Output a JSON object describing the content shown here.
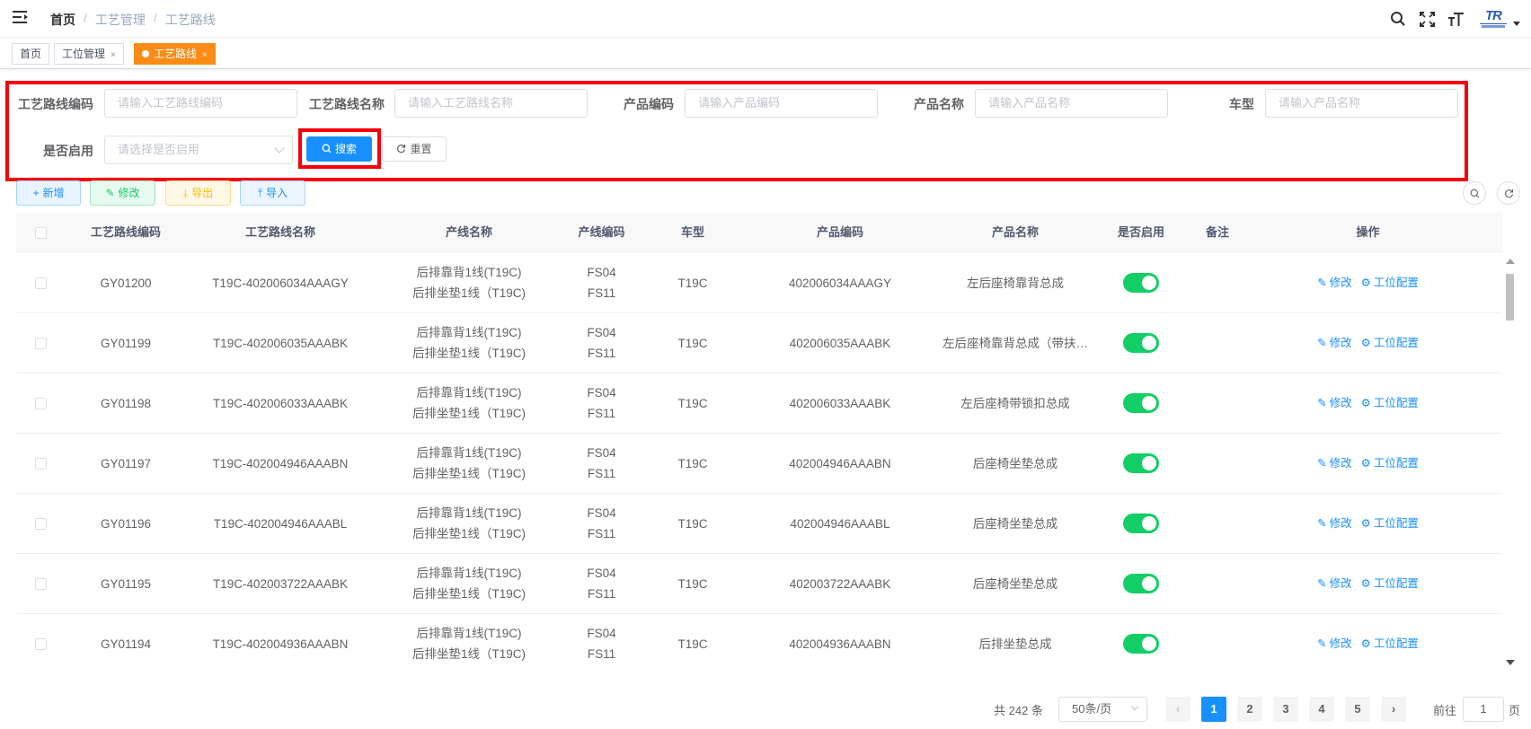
{
  "navbar": {
    "breadcrumb": [
      "首页",
      "工艺管理",
      "工艺路线"
    ],
    "logo_text": "TR"
  },
  "tags": [
    {
      "label": "首页"
    },
    {
      "label": "工位管理"
    },
    {
      "label": "工艺路线"
    }
  ],
  "search": {
    "fields": [
      {
        "label": "工艺路线编码",
        "placeholder": "请输入工艺路线编码"
      },
      {
        "label": "工艺路线名称",
        "placeholder": "请输入工艺路线名称"
      },
      {
        "label": "产品编码",
        "placeholder": "请输入产品编码"
      },
      {
        "label": "产品名称",
        "placeholder": "请输入产品名称"
      },
      {
        "label": "车型",
        "placeholder": "请输入产品名称"
      },
      {
        "label": "是否启用",
        "placeholder": "请选择是否启用"
      }
    ],
    "search_label": "搜索",
    "reset_label": "重置"
  },
  "toolbar": {
    "add": "新增",
    "edit": "修改",
    "export": "导出",
    "import": "导入"
  },
  "table": {
    "headers": [
      "工艺路线编码",
      "工艺路线名称",
      "产线名称",
      "产线编码",
      "车型",
      "产品编码",
      "产品名称",
      "是否启用",
      "备注",
      "操作"
    ],
    "rows": [
      {
        "code": "GY01200",
        "name": "T19C-402006034AAAGY",
        "line1": "后排靠背1线(T19C)",
        "line2": "后排坐垫1线（T19C)",
        "lc1": "FS04",
        "lc2": "FS11",
        "model": "T19C",
        "pcode": "402006034AAAGY",
        "pname": "左后座椅靠背总成",
        "enabled": true,
        "remark": ""
      },
      {
        "code": "GY01199",
        "name": "T19C-402006035AAABK",
        "line1": "后排靠背1线(T19C)",
        "line2": "后排坐垫1线（T19C)",
        "lc1": "FS04",
        "lc2": "FS11",
        "model": "T19C",
        "pcode": "402006035AAABK",
        "pname": "左后座椅靠背总成（带扶…",
        "enabled": true,
        "remark": ""
      },
      {
        "code": "GY01198",
        "name": "T19C-402006033AAABK",
        "line1": "后排靠背1线(T19C)",
        "line2": "后排坐垫1线（T19C)",
        "lc1": "FS04",
        "lc2": "FS11",
        "model": "T19C",
        "pcode": "402006033AAABK",
        "pname": "左后座椅带锁扣总成",
        "enabled": true,
        "remark": ""
      },
      {
        "code": "GY01197",
        "name": "T19C-402004946AAABN",
        "line1": "后排靠背1线(T19C)",
        "line2": "后排坐垫1线（T19C)",
        "lc1": "FS04",
        "lc2": "FS11",
        "model": "T19C",
        "pcode": "402004946AAABN",
        "pname": "后座椅坐垫总成",
        "enabled": true,
        "remark": ""
      },
      {
        "code": "GY01196",
        "name": "T19C-402004946AAABL",
        "line1": "后排靠背1线(T19C)",
        "line2": "后排坐垫1线（T19C)",
        "lc1": "FS04",
        "lc2": "FS11",
        "model": "T19C",
        "pcode": "402004946AAABL",
        "pname": "后座椅坐垫总成",
        "enabled": true,
        "remark": ""
      },
      {
        "code": "GY01195",
        "name": "T19C-402003722AAABK",
        "line1": "后排靠背1线(T19C)",
        "line2": "后排坐垫1线（T19C)",
        "lc1": "FS04",
        "lc2": "FS11",
        "model": "T19C",
        "pcode": "402003722AAABK",
        "pname": "后座椅坐垫总成",
        "enabled": true,
        "remark": ""
      },
      {
        "code": "GY01194",
        "name": "T19C-402004936AAABN",
        "line1": "后排靠背1线(T19C)",
        "line2": "后排坐垫1线（T19C)",
        "lc1": "FS04",
        "lc2": "FS11",
        "model": "T19C",
        "pcode": "402004936AAABN",
        "pname": "后排坐垫总成",
        "enabled": true,
        "remark": ""
      }
    ],
    "op_edit": "修改",
    "op_config": "工位配置"
  },
  "pagination": {
    "total_text": "共 242 条",
    "page_size": "50条/页",
    "pages": [
      "1",
      "2",
      "3",
      "4",
      "5"
    ],
    "current": "1",
    "goto_prefix": "前往",
    "goto_value": "1",
    "goto_suffix": "页"
  },
  "colors": {
    "primary": "#1890ff",
    "active_tag": "#fa8c16",
    "switch_on": "#13ce66",
    "highlight": "#f5000c"
  }
}
